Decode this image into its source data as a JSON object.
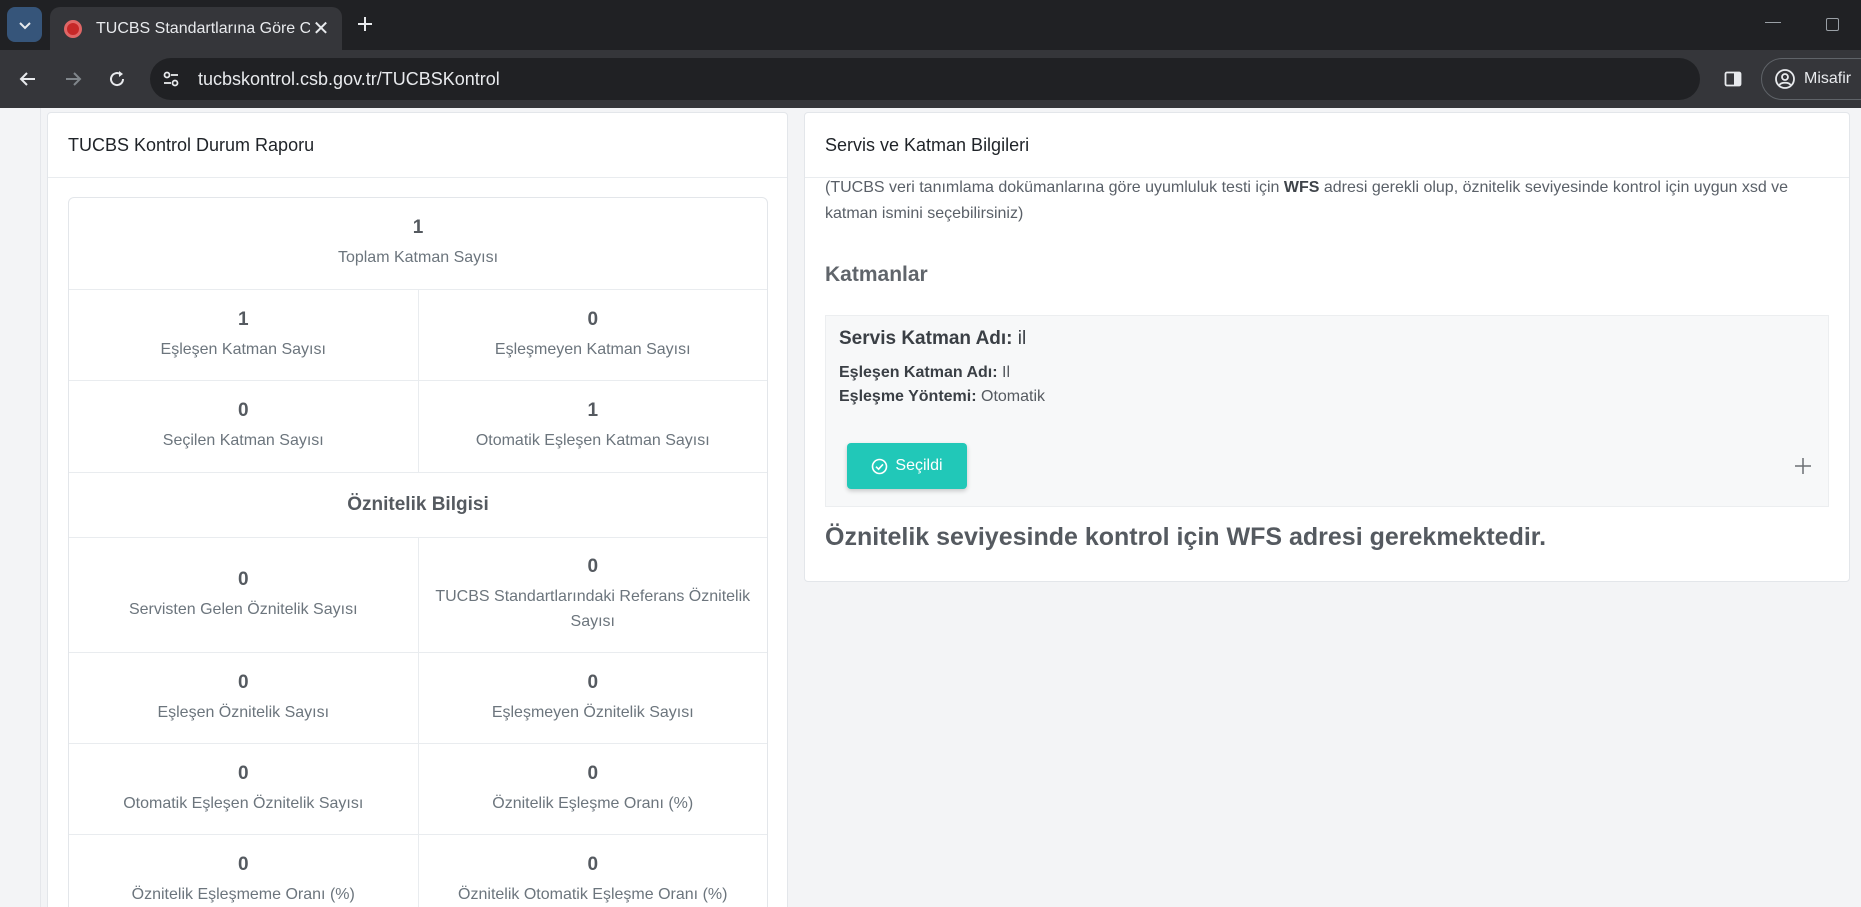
{
  "browser": {
    "tab_title": "TUCBS Standartlarına Göre Coğ",
    "url": "tucbskontrol.csb.gov.tr/TUCBSKontrol",
    "profile_label": "Misafir"
  },
  "report_card": {
    "title": "TUCBS Kontrol Durum Raporu",
    "total_layers": {
      "value": "1",
      "label": "Toplam Katman Sayısı"
    },
    "matched_layers": {
      "value": "1",
      "label": "Eşleşen Katman Sayısı"
    },
    "unmatched_layers": {
      "value": "0",
      "label": "Eşleşmeyen Katman Sayısı"
    },
    "selected_layers": {
      "value": "0",
      "label": "Seçilen Katman Sayısı"
    },
    "auto_matched_layers": {
      "value": "1",
      "label": "Otomatik Eşleşen Katman Sayısı"
    },
    "attribute_section_title": "Öznitelik Bilgisi",
    "service_attributes": {
      "value": "0",
      "label": "Servisten Gelen Öznitelik Sayısı"
    },
    "reference_attributes": {
      "value": "0",
      "label": "TUCBS Standartlarındaki Referans Öznitelik Sayısı"
    },
    "matched_attributes": {
      "value": "0",
      "label": "Eşleşen Öznitelik Sayısı"
    },
    "unmatched_attributes": {
      "value": "0",
      "label": "Eşleşmeyen Öznitelik Sayısı"
    },
    "auto_matched_attributes": {
      "value": "0",
      "label": "Otomatik Eşleşen Öznitelik Sayısı"
    },
    "attribute_match_ratio": {
      "value": "0",
      "label": "Öznitelik Eşleşme Oranı (%)"
    },
    "attribute_mismatch_ratio": {
      "value": "0",
      "label": "Öznitelik Eşleşmeme Oranı (%)"
    },
    "attribute_auto_match_ratio": {
      "value": "0",
      "label": "Öznitelik Otomatik Eşleşme Oranı (%)"
    }
  },
  "service_card": {
    "title": "Servis ve Katman Bilgileri",
    "desc_part1": "(TUCBS veri tanımlama dokümanlarına göre uyumluluk testi için ",
    "desc_bold": "WFS",
    "desc_part2": " adresi gerekli olup, öznitelik seviyesinde kontrol için uygun xsd ve katman ismini seçebilirsiniz)",
    "layers_heading": "Katmanlar",
    "layer": {
      "service_layer_label": "Servis Katman Adı:",
      "service_layer_value": "il",
      "matched_layer_label": "Eşleşen Katman Adı:",
      "matched_layer_value": "Il",
      "match_method_label": "Eşleşme Yöntemi:",
      "match_method_value": "Otomatik",
      "selected_button": "Seçildi"
    },
    "notice": "Öznitelik seviyesinde kontrol için WFS adresi gerekmektedir."
  }
}
